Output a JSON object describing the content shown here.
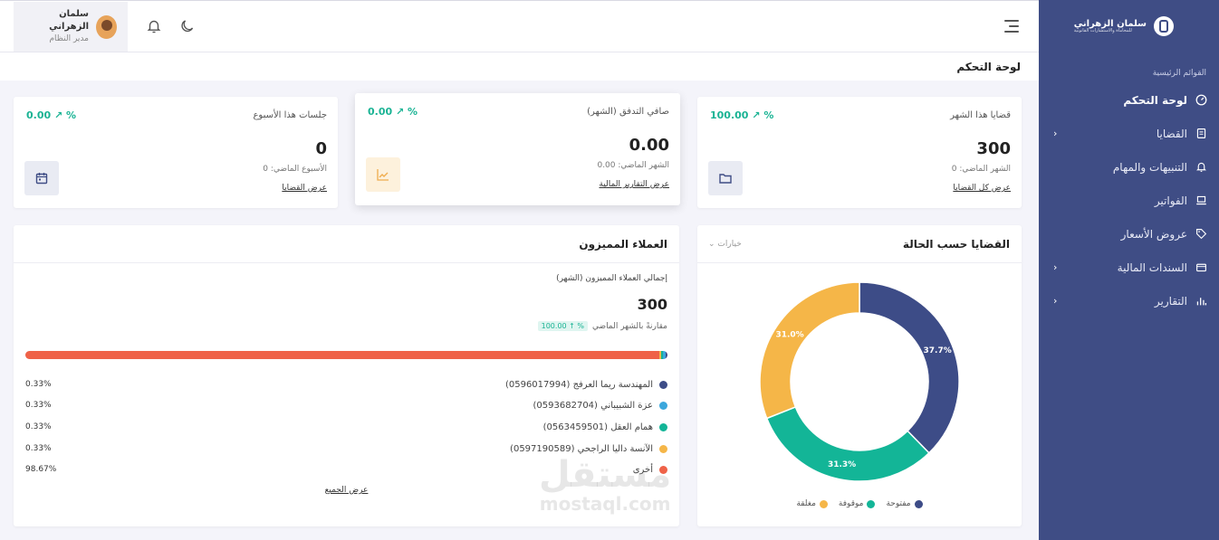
{
  "sidebar": {
    "brand_name": "سلمان الزهراني",
    "brand_sub": "للمحاماة والاستشارات القانونية",
    "section_title": "القوائم الرئيسية",
    "items": [
      {
        "label": "لوحة التحكم",
        "icon": "gauge-icon"
      },
      {
        "label": "القضايا",
        "icon": "document-icon"
      },
      {
        "label": "التنبيهات والمهام",
        "icon": "bell-icon"
      },
      {
        "label": "الفواتير",
        "icon": "laptop-icon"
      },
      {
        "label": "عروض الأسعار",
        "icon": "tag-icon"
      },
      {
        "label": "السندات المالية",
        "icon": "wallet-icon"
      },
      {
        "label": "التقارير",
        "icon": "bar-chart-icon"
      }
    ]
  },
  "user": {
    "name": "سلمان الزهراني",
    "role": "مدير النظام"
  },
  "page_title": "لوحة التحكم",
  "stats": [
    {
      "label": "قضايا هذا الشهر",
      "change": "100.00 ↗ %",
      "value": "300",
      "prev": "الشهر الماضي: 0",
      "link": "عرض كل القضايا",
      "icon": "folder-icon",
      "icon_bg": "#e9ebf3",
      "icon_color": "#3f4d85"
    },
    {
      "label": "صافي التدفق (الشهر)",
      "change": "0.00 ↗ %",
      "value": "0.00",
      "prev": "الشهر الماضي: 0.00",
      "link": "عرض التقارير المالية",
      "icon": "line-chart-icon",
      "icon_bg": "#fdf1dc",
      "icon_color": "#f0ad4e"
    },
    {
      "label": "جلسات هذا الأسبوع",
      "change": "0.00 ↗ %",
      "value": "0",
      "prev": "الأسبوع الماضي: 0",
      "link": "عرض القضايا",
      "icon": "calendar-icon",
      "icon_bg": "#e9ebf3",
      "icon_color": "#3f4d85"
    }
  ],
  "status_card": {
    "title": "القضايا حسب الحالة",
    "options": "خيارات"
  },
  "chart_data": {
    "type": "pie",
    "categories": [
      "مفتوحة",
      "موقوفة",
      "مغلقة"
    ],
    "values": [
      37.7,
      31.3,
      31.0
    ],
    "labels": [
      "37.7%",
      "31.3%",
      "31.0%"
    ],
    "colors": [
      "#3d4c87",
      "#13b597",
      "#f5b648"
    ]
  },
  "clients_card": {
    "title": "العملاء المميزون",
    "subtitle": "إجمالي العملاء المميزون (الشهر)",
    "total": "300",
    "badge": "100.00 ↑ %",
    "compare": "مقارنةً بالشهر الماضي",
    "view_all": "عرض الجميع",
    "clients": [
      {
        "name": "المهندسة ريما العرفج (0596017994)",
        "pct": "0.33%",
        "value": 0.33,
        "color": "#3d4c87"
      },
      {
        "name": "عزة الشبيباني (0593682704)",
        "pct": "0.33%",
        "value": 0.33,
        "color": "#3ba7dc"
      },
      {
        "name": "همام العقل (0563459501)",
        "pct": "0.33%",
        "value": 0.33,
        "color": "#13b597"
      },
      {
        "name": "الآنسة داليا الراجحي (0597190589)",
        "pct": "0.33%",
        "value": 0.33,
        "color": "#f5b648"
      },
      {
        "name": "أخرى",
        "pct": "98.67%",
        "value": 98.67,
        "color": "#ef6248"
      }
    ]
  },
  "watermark": {
    "ar": "مستقل",
    "en": "mostaql.com"
  }
}
